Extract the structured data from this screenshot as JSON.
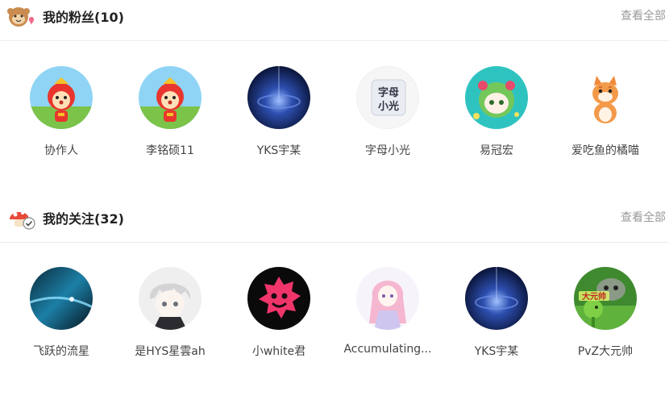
{
  "fans": {
    "title": "我的粉丝(10)",
    "view_all": "查看全部",
    "icon": "monkey-heart-icon",
    "users": [
      {
        "name": "协作人",
        "avatar": "cartoon-red-bird-avatar"
      },
      {
        "name": "李铭硕11",
        "avatar": "cartoon-red-bird-avatar"
      },
      {
        "name": "YKS宇某",
        "avatar": "galaxy-avatar"
      },
      {
        "name": "字母小光",
        "avatar": "text-avatar",
        "avatar_text": "字母小光"
      },
      {
        "name": "易冠宏",
        "avatar": "green-girl-avatar"
      },
      {
        "name": "爱吃鱼的橘喵",
        "avatar": "orange-cat-avatar"
      }
    ]
  },
  "follows": {
    "title": "我的关注(32)",
    "view_all": "查看全部",
    "icon": "mushroom-check-icon",
    "users": [
      {
        "name": "飞跃的流星",
        "avatar": "blue-space-avatar"
      },
      {
        "name": "是HYS星雲ah",
        "avatar": "anime-boy-avatar"
      },
      {
        "name": "小white君",
        "avatar": "pink-monster-avatar"
      },
      {
        "name": "Accumulating...",
        "avatar": "anime-girl-avatar"
      },
      {
        "name": "YKS宇某",
        "avatar": "galaxy-avatar"
      },
      {
        "name": "PvZ大元帅",
        "avatar": "plants-zombies-avatar",
        "avatar_text": "大元帅"
      }
    ]
  }
}
